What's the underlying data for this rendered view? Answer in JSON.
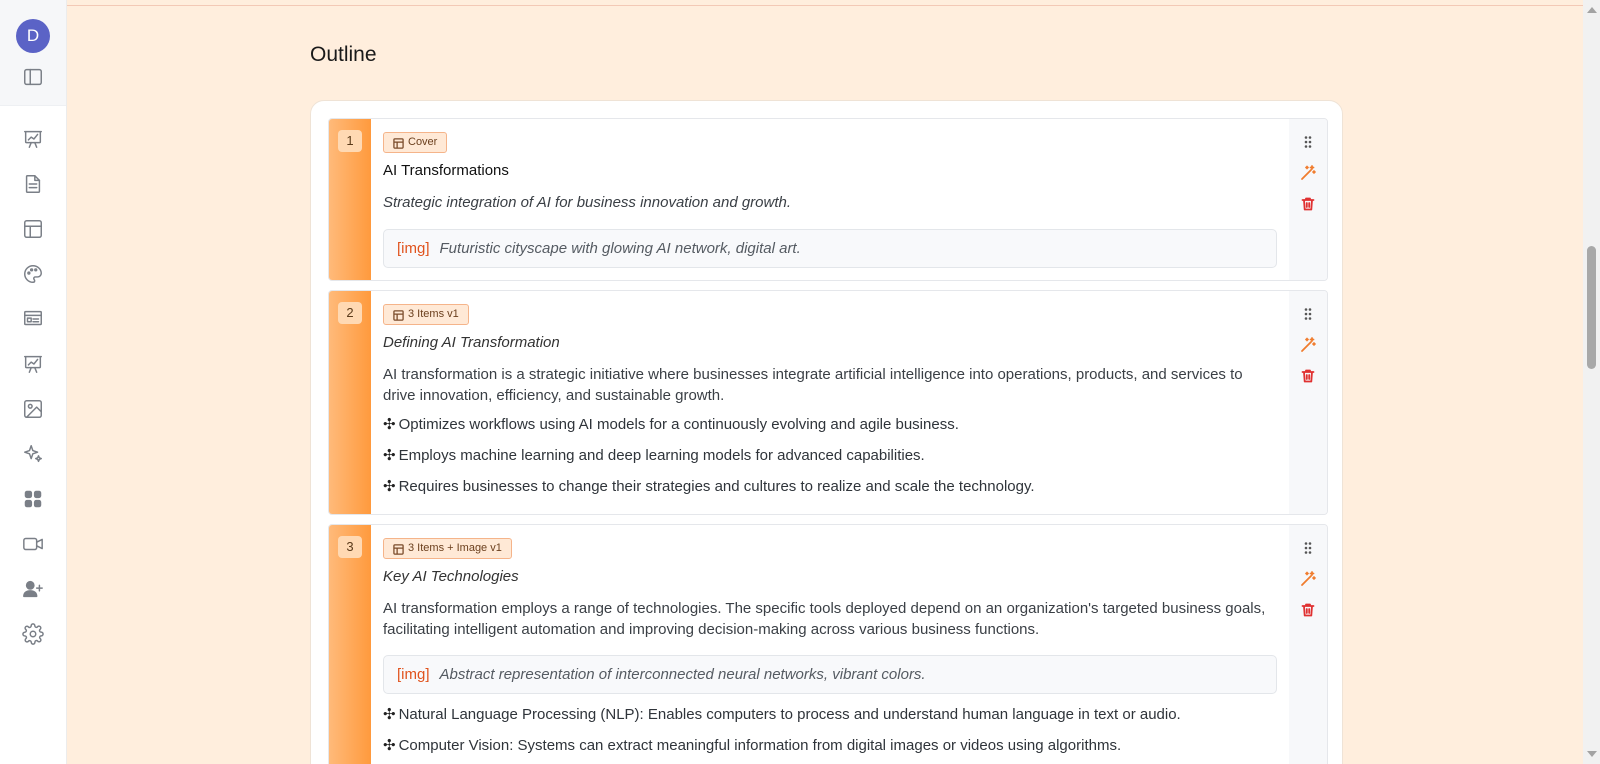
{
  "user": {
    "avatar_initial": "D"
  },
  "sidebar": {
    "icons": [
      "toggle-sidebar-icon",
      "presentation-chart-icon",
      "document-icon",
      "layout-icon",
      "palette-icon",
      "slide-card-icon",
      "presentation-chart-icon",
      "image-icon",
      "sparkles-icon",
      "apps-icon",
      "video-icon",
      "add-user-icon",
      "settings-icon"
    ]
  },
  "page": {
    "title": "Outline"
  },
  "slides": [
    {
      "number": "1",
      "layout": "Cover",
      "title": "AI Transformations",
      "subtitle": "Strategic integration of AI for business innovation and growth.",
      "image_tag": "[img]",
      "image_description": "Futuristic cityscape with glowing AI network, digital art."
    },
    {
      "number": "2",
      "layout": "3 Items v1",
      "title": "Defining AI Transformation",
      "body": "AI transformation is a strategic initiative where businesses integrate artificial intelligence into operations, products, and services to drive innovation, efficiency, and sustainable growth.",
      "bullet_symbol": "✣",
      "bullets": [
        "Optimizes workflows using AI models for a continuously evolving and agile business.",
        "Employs machine learning and deep learning models for advanced capabilities.",
        "Requires businesses to change their strategies and cultures to realize and scale the technology."
      ]
    },
    {
      "number": "3",
      "layout": "3 Items + Image v1",
      "title": "Key AI Technologies",
      "body": "AI transformation employs a range of technologies. The specific tools deployed depend on an organization's targeted business goals, facilitating intelligent automation and improving decision-making across various business functions.",
      "image_tag": "[img]",
      "image_description": "Abstract representation of interconnected neural networks, vibrant colors.",
      "bullet_symbol": "✣",
      "bullets": [
        "Natural Language Processing (NLP): Enables computers to process and understand human language in text or audio.",
        "Computer Vision: Systems can extract meaningful information from digital images or videos using algorithms."
      ]
    }
  ],
  "colors": {
    "accent": "#ff9a3d",
    "background": "#ffeedd",
    "avatar": "#5b63c6",
    "delete": "#e03131",
    "magic": "#f07c2e"
  }
}
